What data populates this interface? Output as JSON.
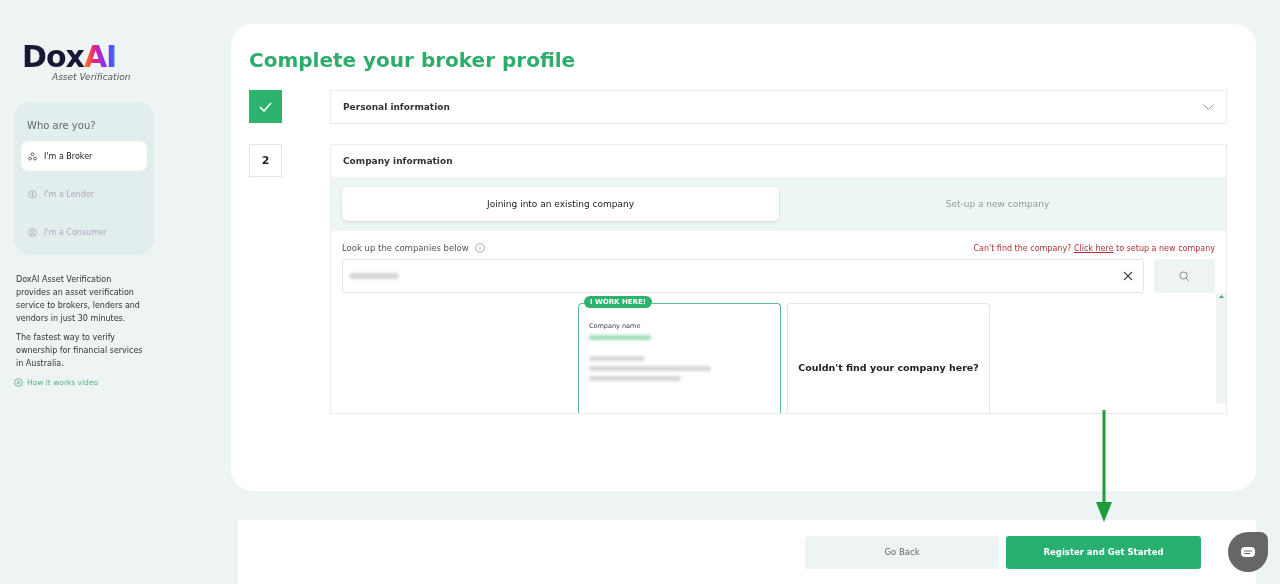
{
  "logo": {
    "wordmark": "Dox",
    "mark": "AI",
    "subtitle": "Asset Verification"
  },
  "role_picker": {
    "title": "Who are you?",
    "items": [
      {
        "label": "I'm a Broker",
        "kind": "broker",
        "selected": true
      },
      {
        "label": "I'm a Lender",
        "kind": "lender",
        "selected": false
      },
      {
        "label": "I'm a Consumer",
        "kind": "consumer",
        "selected": false
      }
    ]
  },
  "about": [
    "DoxAI Asset Verification provides an asset verification service to brokers, lenders and vendors in just 30 minutes.",
    "The fastest way to verify ownership for financial services in Australia."
  ],
  "video_link": "How it works video",
  "title": "Complete your broker profile",
  "steps": [
    {
      "kind": "done",
      "label": "Personal information",
      "expanded": false
    },
    {
      "kind": "current",
      "number": "2",
      "label": "Company information",
      "expanded": true
    }
  ],
  "company_tabs": [
    {
      "label": "Joining into an existing company",
      "selected": true
    },
    {
      "label": "Set-up a new company",
      "selected": false
    }
  ],
  "lookup": {
    "label": "Look up the companies below",
    "missing_before": "Can't find the company?",
    "missing_link": "Click here",
    "missing_after": "to setup a new company"
  },
  "results": [
    {
      "kind": "company",
      "badge": "I WORK HERE!",
      "field_label": "Company name",
      "selected": true
    },
    {
      "kind": "not_found",
      "text": "Couldn't find your company here?",
      "selected": false
    }
  ],
  "buttons": [
    {
      "label": "Go Back",
      "kind": "secondary"
    },
    {
      "label": "Register and Get Started",
      "kind": "primary"
    }
  ]
}
